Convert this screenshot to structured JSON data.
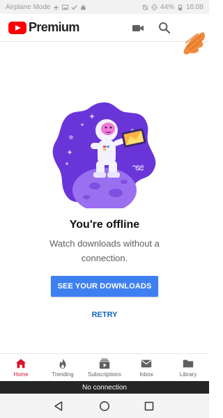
{
  "status_bar": {
    "left_text": "Airplane Mode",
    "battery": "44%",
    "time": "16:08"
  },
  "app_bar": {
    "brand": "Premium",
    "brand_color": "#ff0000",
    "icons": [
      "cast-icon",
      "search-icon",
      "avatar"
    ]
  },
  "offline": {
    "title": "You're offline",
    "subtitle": "Watch downloads without a connection.",
    "primary_button": "SEE YOUR DOWNLOADS",
    "retry_button": "RETRY",
    "accent_color": "#3e80f0"
  },
  "bottom_nav": {
    "items": [
      {
        "label": "Home",
        "icon": "home-icon",
        "active": true
      },
      {
        "label": "Trending",
        "icon": "flame-icon",
        "active": false
      },
      {
        "label": "Subscriptions",
        "icon": "subscriptions-icon",
        "active": false
      },
      {
        "label": "Inbox",
        "icon": "mail-icon",
        "active": false
      },
      {
        "label": "Library",
        "icon": "folder-icon",
        "active": false
      }
    ],
    "active_color": "#d7152b"
  },
  "banner": {
    "text": "No connection"
  },
  "system_nav": {
    "icons": [
      "back-icon",
      "home-circle-icon",
      "recents-icon"
    ]
  }
}
